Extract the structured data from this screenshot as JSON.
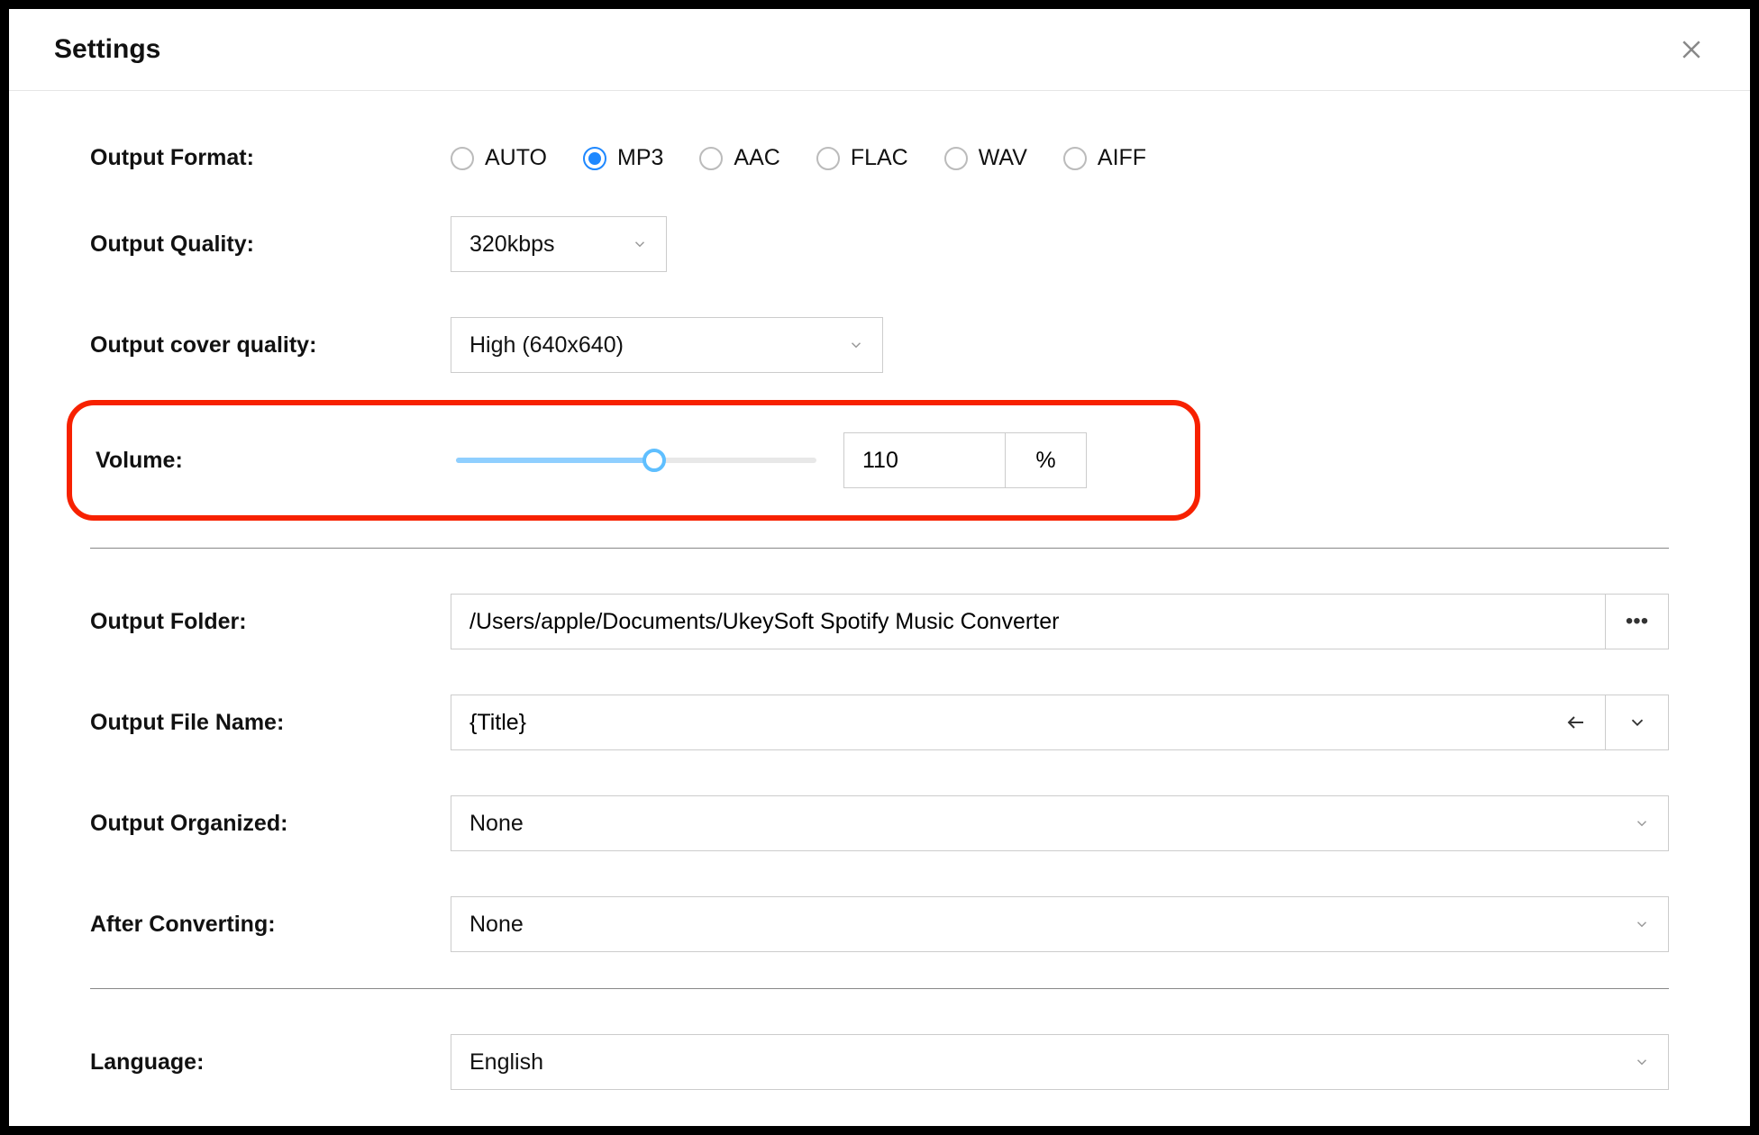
{
  "header": {
    "title": "Settings"
  },
  "labels": {
    "format": "Output Format:",
    "quality": "Output Quality:",
    "cover": "Output cover quality:",
    "volume": "Volume:",
    "folder": "Output Folder:",
    "filename": "Output File Name:",
    "organized": "Output Organized:",
    "after": "After Converting:",
    "language": "Language:"
  },
  "format": {
    "options": [
      "AUTO",
      "MP3",
      "AAC",
      "FLAC",
      "WAV",
      "AIFF"
    ],
    "selected": "MP3"
  },
  "quality": {
    "value": "320kbps"
  },
  "cover": {
    "value": "High (640x640)"
  },
  "volume": {
    "value": "110",
    "unit": "%",
    "percent": 55
  },
  "folder": {
    "value": "/Users/apple/Documents/UkeySoft Spotify Music Converter"
  },
  "filename": {
    "value": "{Title}"
  },
  "organized": {
    "value": "None"
  },
  "after": {
    "value": "None"
  },
  "language": {
    "value": "English"
  }
}
